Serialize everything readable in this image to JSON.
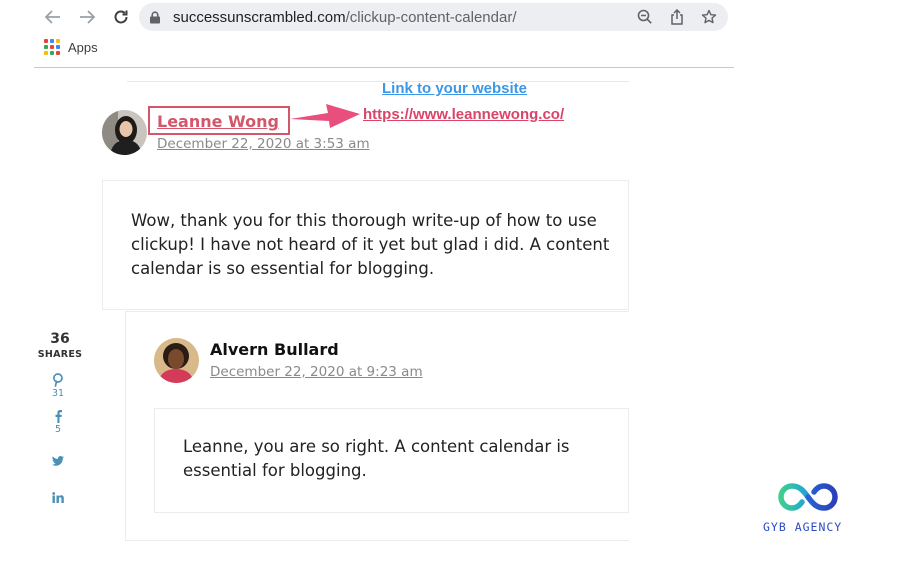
{
  "browser": {
    "url_host": "successunscrambled.com",
    "url_path": "/clickup-content-calendar/",
    "bookmarks": {
      "apps_label": "Apps"
    }
  },
  "annotation": {
    "title": "Link to your website",
    "url": "https://www.leannewong.co/",
    "highlight_color": "#d4566b",
    "arrow_color": "#e84f7d",
    "title_color": "#3b97e8"
  },
  "comments": [
    {
      "author": "Leanne Wong",
      "date": "December 22, 2020 at 3:53 am",
      "text": "Wow, thank you for this thorough write-up of how to use clickup! I have not heard of it yet but glad i did. A content calendar is so essential for blogging.",
      "author_color": "#d4566b"
    },
    {
      "author": "Alvern Bullard",
      "date": "December 22, 2020 at 9:23 am",
      "text": "Leanne, you are so right. A content calendar is essential for blogging.",
      "author_color": "#111111"
    }
  ],
  "share_bar": {
    "count": "36",
    "label": "SHARES",
    "networks": [
      {
        "name": "pinterest",
        "icon": "pinterest-icon",
        "count": "31"
      },
      {
        "name": "facebook",
        "icon": "facebook-icon",
        "count": "5"
      },
      {
        "name": "twitter",
        "icon": "twitter-icon",
        "count": ""
      },
      {
        "name": "linkedin",
        "icon": "linkedin-icon",
        "count": ""
      }
    ],
    "icon_color": "#4b8fb5"
  },
  "watermark": {
    "text": "GYB AGENCY"
  }
}
